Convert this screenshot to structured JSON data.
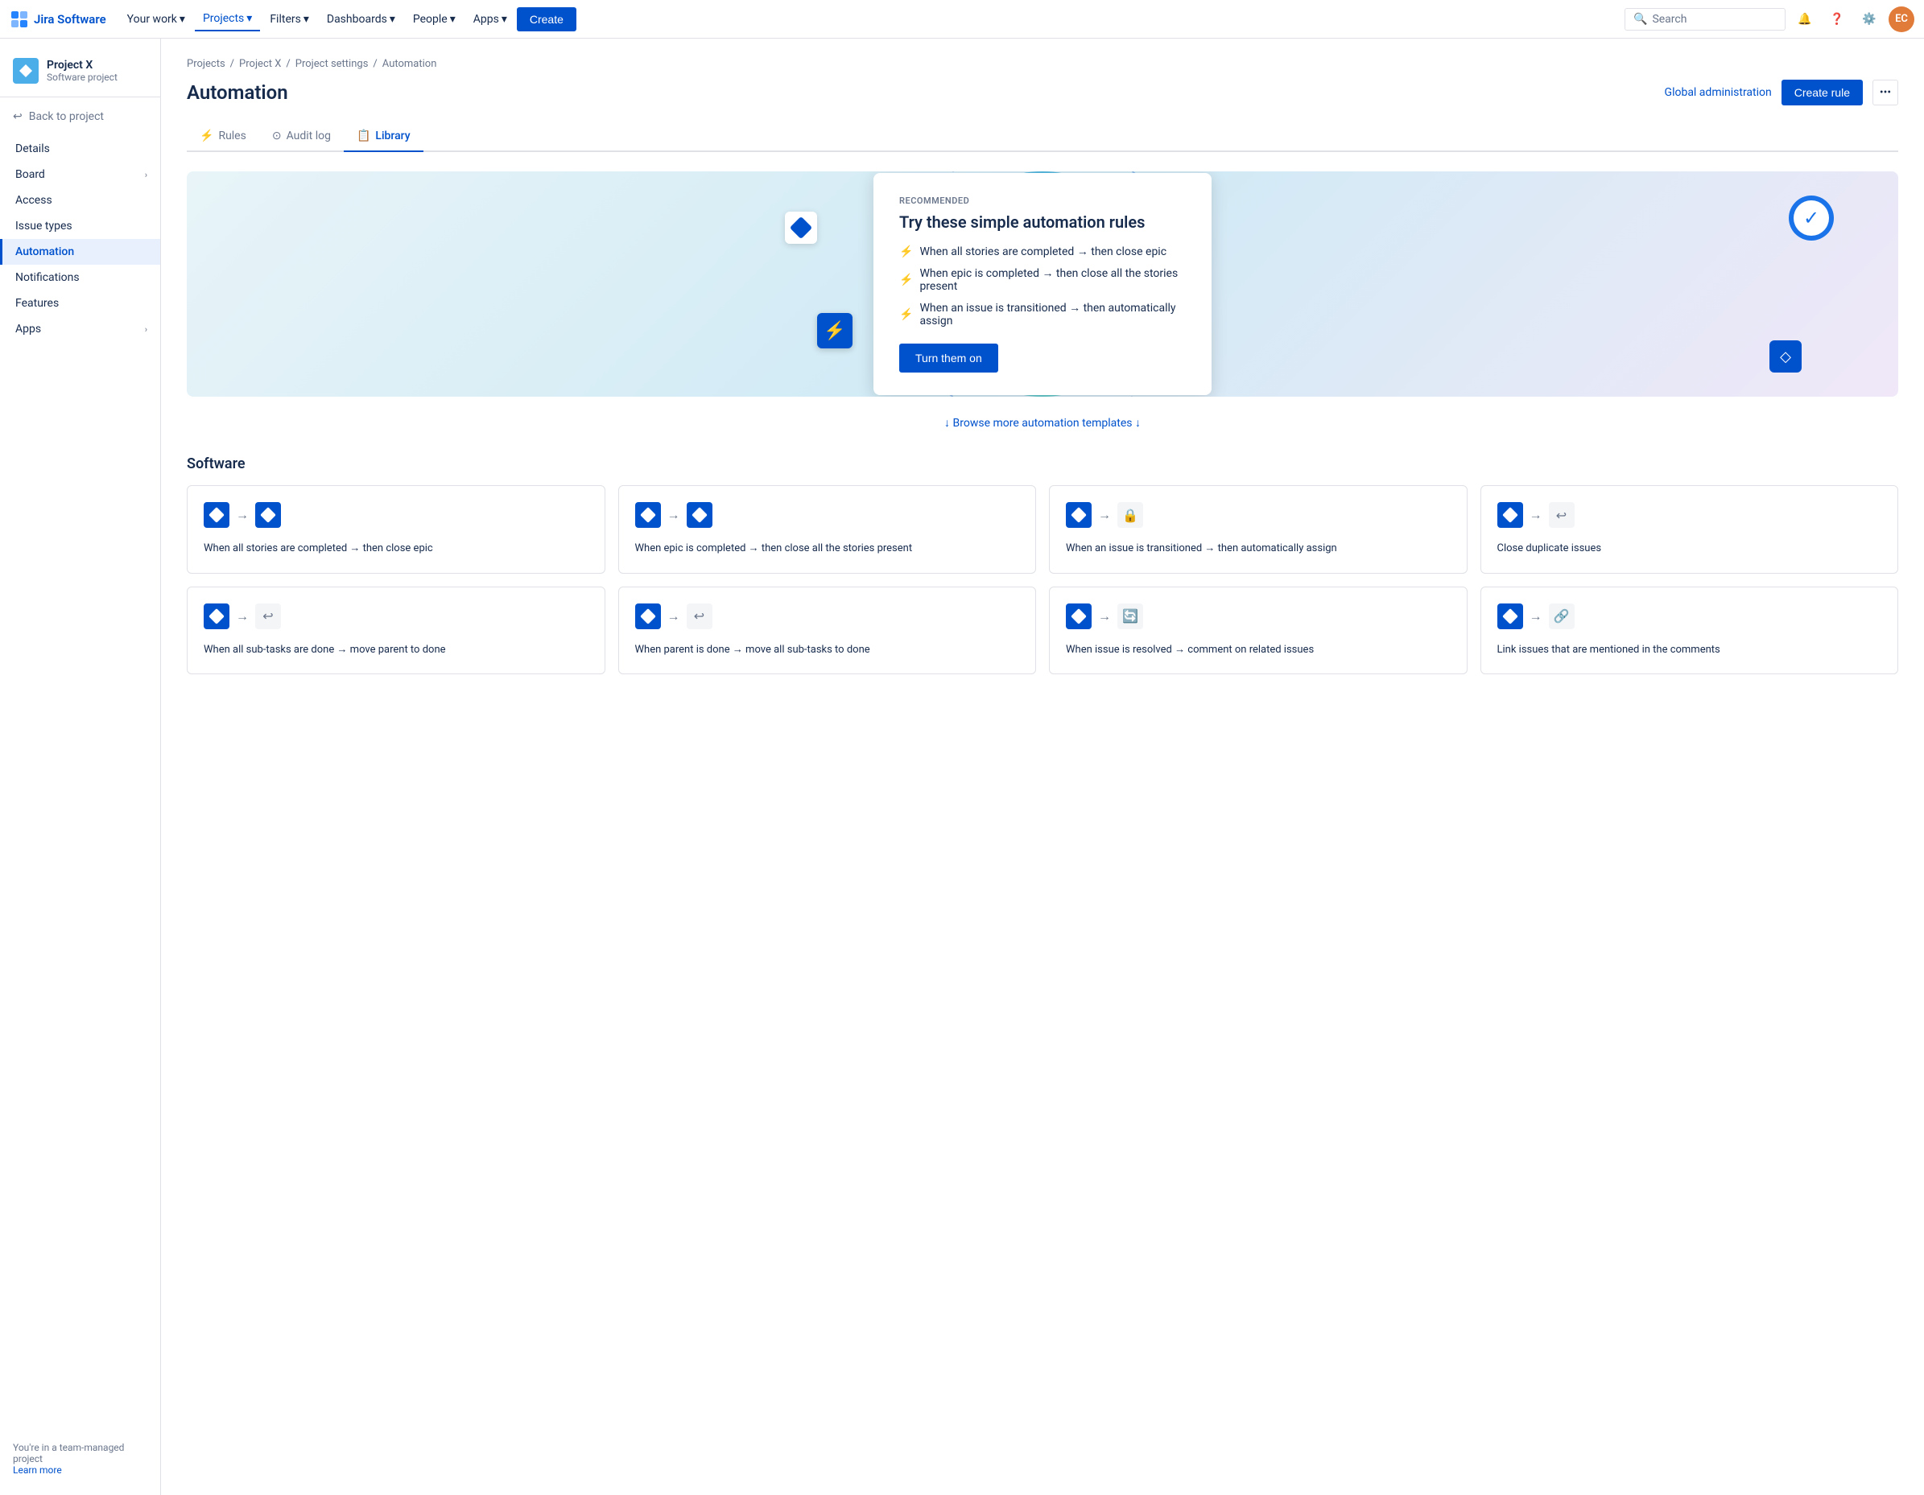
{
  "topnav": {
    "logo_text": "Jira Software",
    "nav_items": [
      {
        "label": "Your work",
        "has_dropdown": true,
        "active": false
      },
      {
        "label": "Projects",
        "has_dropdown": true,
        "active": true
      },
      {
        "label": "Filters",
        "has_dropdown": true,
        "active": false
      },
      {
        "label": "Dashboards",
        "has_dropdown": true,
        "active": false
      },
      {
        "label": "People",
        "has_dropdown": true,
        "active": false
      },
      {
        "label": "Apps",
        "has_dropdown": true,
        "active": false
      }
    ],
    "create_label": "Create",
    "search_placeholder": "Search",
    "avatar_text": "EC"
  },
  "sidebar": {
    "project_name": "Project X",
    "project_type": "Software project",
    "back_label": "Back to project",
    "nav_items": [
      {
        "label": "Details",
        "active": false,
        "has_chevron": false
      },
      {
        "label": "Board",
        "active": false,
        "has_chevron": true
      },
      {
        "label": "Access",
        "active": false,
        "has_chevron": false
      },
      {
        "label": "Issue types",
        "active": false,
        "has_chevron": false
      },
      {
        "label": "Automation",
        "active": true,
        "has_chevron": false
      },
      {
        "label": "Notifications",
        "active": false,
        "has_chevron": false
      },
      {
        "label": "Features",
        "active": false,
        "has_chevron": false
      },
      {
        "label": "Apps",
        "active": false,
        "has_chevron": true
      }
    ],
    "footer_text": "You're in a team-managed project",
    "footer_link": "Learn more"
  },
  "breadcrumb": {
    "items": [
      "Projects",
      "Project X",
      "Project settings",
      "Automation"
    ]
  },
  "page_header": {
    "title": "Automation",
    "global_admin_label": "Global administration",
    "create_rule_label": "Create rule",
    "more_icon": "⋯"
  },
  "tabs": [
    {
      "label": "Rules",
      "active": false,
      "icon": "⚡"
    },
    {
      "label": "Audit log",
      "active": false,
      "icon": "○"
    },
    {
      "label": "Library",
      "active": true,
      "icon": "📋"
    }
  ],
  "hero": {
    "recommended_label": "RECOMMENDED",
    "title": "Try these simple automation rules",
    "rules": [
      "When all stories are completed → then close epic",
      "When epic is completed → then close all the stories present",
      "When an issue is transitioned → then automatically assign"
    ],
    "turn_on_label": "Turn them on"
  },
  "browse_more": {
    "label": "↓ Browse more automation templates ↓"
  },
  "software_section": {
    "title": "Software",
    "cards": [
      {
        "left_icon": "diamond",
        "right_icon": "diamond",
        "text": "When all stories are completed → then close epic"
      },
      {
        "left_icon": "diamond",
        "right_icon": "diamond",
        "text": "When epic is completed → then close all the stories present"
      },
      {
        "left_icon": "diamond",
        "right_icon": "lock",
        "text": "When an issue is transitioned → then automatically assign"
      },
      {
        "left_icon": "diamond",
        "right_icon": "loop",
        "text": "Close duplicate issues"
      },
      {
        "left_icon": "diamond",
        "right_icon": "loop",
        "text": "When all sub-tasks are done → move parent to done"
      },
      {
        "left_icon": "diamond",
        "right_icon": "loop",
        "text": "When parent is done → move all sub-tasks to done"
      },
      {
        "left_icon": "diamond",
        "right_icon": "refresh",
        "text": "When issue is resolved → comment on related issues"
      },
      {
        "left_icon": "diamond",
        "right_icon": "link",
        "text": "Link issues that are mentioned in the comments"
      }
    ]
  }
}
